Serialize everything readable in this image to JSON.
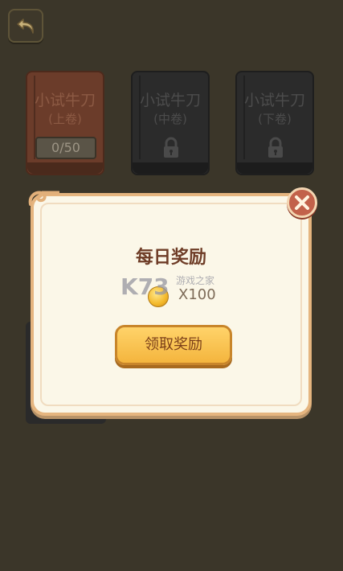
{
  "books": [
    {
      "title": "小试牛刀",
      "sub": "(上卷)",
      "progress": "0/50",
      "locked": false
    },
    {
      "title": "小试牛刀",
      "sub": "(中卷)",
      "locked": true
    },
    {
      "title": "小试牛刀",
      "sub": "(下卷)",
      "locked": true
    }
  ],
  "dialog": {
    "title": "每日奖励",
    "reward_text": "X100",
    "claim_label": "领取奖励"
  },
  "watermark": {
    "logo": "K73",
    "site": "游戏之家"
  },
  "icons": {
    "back": "back-arrow-icon",
    "close": "close-icon",
    "lock": "lock-icon",
    "coin": "coin-icon"
  },
  "colors": {
    "background": "#3b3629",
    "dialog_bg": "#fbf7e8",
    "dialog_border": "#e5b57f",
    "button": "#f4b53e",
    "close": "#c2614a"
  }
}
